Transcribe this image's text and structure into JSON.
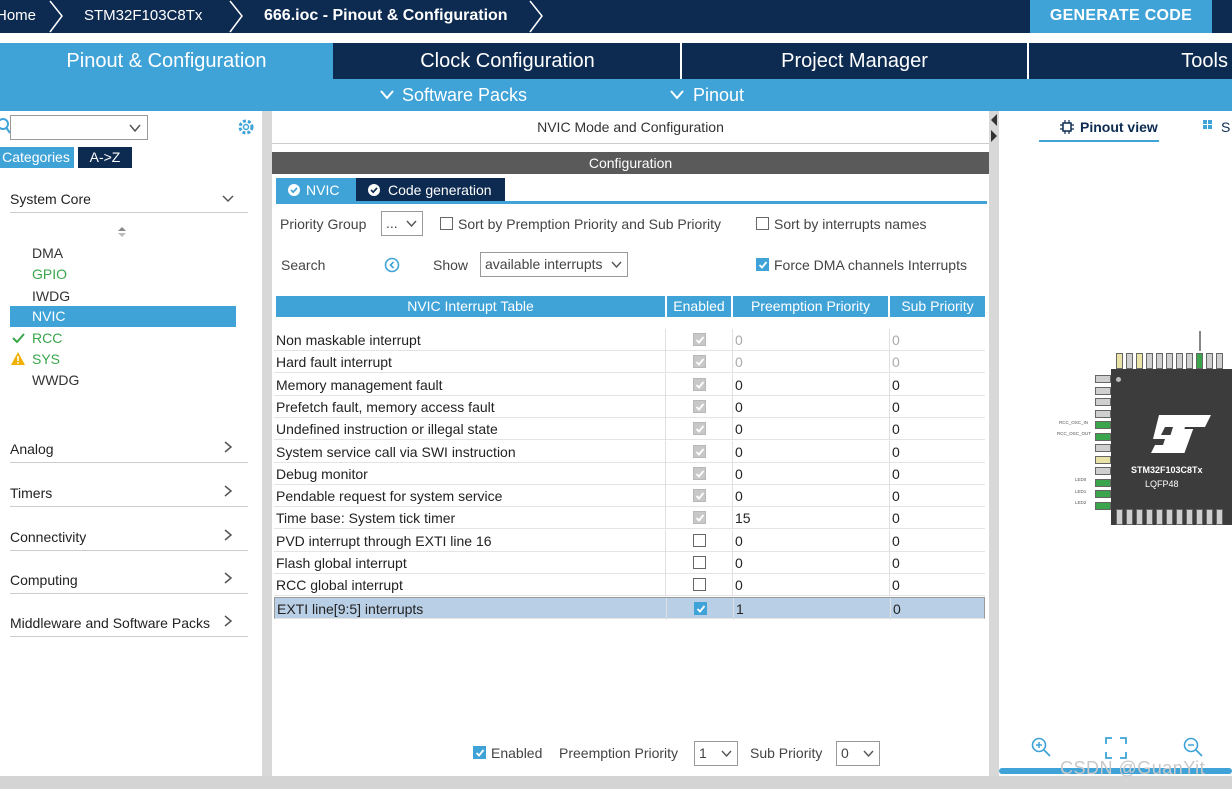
{
  "breadcrumb": {
    "home": "Home",
    "chip": "STM32F103C8Tx",
    "file": "666.ioc - Pinout & Configuration"
  },
  "generate_label": "GENERATE CODE",
  "main_tabs": [
    "Pinout & Configuration",
    "Clock Configuration",
    "Project Manager",
    "Tools"
  ],
  "sub_bar": [
    "Software Packs",
    "Pinout"
  ],
  "sidebar": {
    "cat_tabs": [
      "Categories",
      "A->Z"
    ],
    "system_core": "System Core",
    "items": [
      {
        "label": "DMA",
        "state": "normal"
      },
      {
        "label": "GPIO",
        "state": "green"
      },
      {
        "label": "IWDG",
        "state": "normal"
      },
      {
        "label": "NVIC",
        "state": "selected"
      },
      {
        "label": "RCC",
        "state": "check"
      },
      {
        "label": "SYS",
        "state": "warning"
      },
      {
        "label": "WWDG",
        "state": "normal"
      }
    ],
    "groups": [
      "Analog",
      "Timers",
      "Connectivity",
      "Computing",
      "Middleware and Software Packs"
    ]
  },
  "center": {
    "mode_title": "NVIC Mode and Configuration",
    "configuration": "Configuration",
    "tabs": [
      "NVIC",
      "Code generation"
    ],
    "priority_group_label": "Priority Group",
    "priority_group_value": "...",
    "sort_premption": "Sort by Premption Priority and Sub Priority",
    "sort_names": "Sort by interrupts names",
    "search_label": "Search",
    "show_label": "Show",
    "show_value": "available interrupts",
    "force_dma": "Force DMA channels Interrupts",
    "table_headers": [
      "NVIC Interrupt Table",
      "Enabled",
      "Preemption Priority",
      "Sub Priority"
    ],
    "rows": [
      {
        "name": "Non maskable interrupt",
        "enabled": true,
        "locked": true,
        "pre": "0",
        "sub": "0",
        "grey": true
      },
      {
        "name": "Hard fault interrupt",
        "enabled": true,
        "locked": true,
        "pre": "0",
        "sub": "0",
        "grey": true
      },
      {
        "name": "Memory management fault",
        "enabled": true,
        "locked": true,
        "pre": "0",
        "sub": "0",
        "grey": false
      },
      {
        "name": "Prefetch fault, memory access fault",
        "enabled": true,
        "locked": true,
        "pre": "0",
        "sub": "0",
        "grey": false
      },
      {
        "name": "Undefined instruction or illegal state",
        "enabled": true,
        "locked": true,
        "pre": "0",
        "sub": "0",
        "grey": false
      },
      {
        "name": "System service call via SWI instruction",
        "enabled": true,
        "locked": true,
        "pre": "0",
        "sub": "0",
        "grey": false
      },
      {
        "name": "Debug monitor",
        "enabled": true,
        "locked": true,
        "pre": "0",
        "sub": "0",
        "grey": false
      },
      {
        "name": "Pendable request for system service",
        "enabled": true,
        "locked": true,
        "pre": "0",
        "sub": "0",
        "grey": false
      },
      {
        "name": "Time base: System tick timer",
        "enabled": true,
        "locked": true,
        "pre": "15",
        "sub": "0",
        "grey": false
      },
      {
        "name": "PVD interrupt through EXTI line 16",
        "enabled": false,
        "locked": false,
        "pre": "0",
        "sub": "0",
        "grey": false
      },
      {
        "name": "Flash global interrupt",
        "enabled": false,
        "locked": false,
        "pre": "0",
        "sub": "0",
        "grey": false
      },
      {
        "name": "RCC global interrupt",
        "enabled": false,
        "locked": false,
        "pre": "0",
        "sub": "0",
        "grey": false
      },
      {
        "name": "EXTI line[9:5] interrupts",
        "enabled": true,
        "locked": false,
        "pre": "1",
        "sub": "0",
        "grey": false,
        "selected": true
      }
    ],
    "bottom_enabled": "Enabled",
    "bottom_pre_label": "Preemption Priority",
    "bottom_pre_value": "1",
    "bottom_sub_label": "Sub Priority",
    "bottom_sub_value": "0"
  },
  "right": {
    "pinout_view": "Pinout view",
    "system_view": "S",
    "chip_label": "STM32F103C8Tx",
    "package": "LQFP48",
    "pin_left_labels": [
      "RCC_OSC_IN",
      "RCC_OSC_OUT",
      "LED0",
      "LED1",
      "LED2"
    ]
  },
  "watermark": "CSDN @GuanYit",
  "colors": {
    "navy": "#0d2b50",
    "accent": "#3fa3d8",
    "green": "#3aa54a",
    "warning": "#f2b100",
    "selected_row": "#b9cfe6"
  }
}
